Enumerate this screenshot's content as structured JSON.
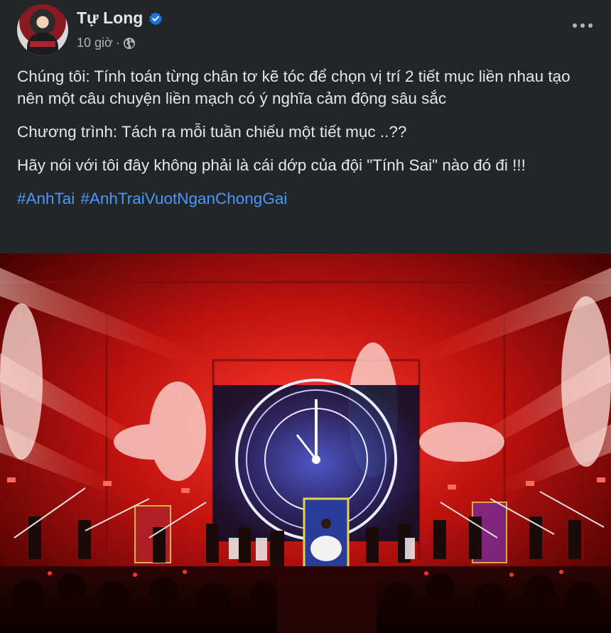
{
  "post": {
    "author": "Tự Long",
    "time": "10 giờ",
    "separator": "·",
    "paragraphs": [
      "Chúng tôi: Tính toán từng chân tơ kẽ tóc để chọn vị trí 2 tiết mục liền nhau tạo nên một câu chuyện liền mạch có ý nghĩa cảm động sâu sắc",
      "Chương trình: Tách ra mỗi tuần chiếu một tiết mục ..??",
      "Hãy nói với tôi đây không phải là cái dớp của đội \"Tính Sai\" nào đó đi !!!"
    ],
    "hashtags": [
      "#AnhTai",
      "#AnhTraiVuotNganChongGai"
    ]
  },
  "icons": {
    "verified": "verified-badge-icon",
    "privacy": "globe-icon",
    "more": "more-options-icon"
  },
  "colors": {
    "background": "#242526",
    "text": "#e4e6eb",
    "secondary": "#b0b3b8",
    "link": "#4599ff",
    "verified": "#1b74e4"
  }
}
